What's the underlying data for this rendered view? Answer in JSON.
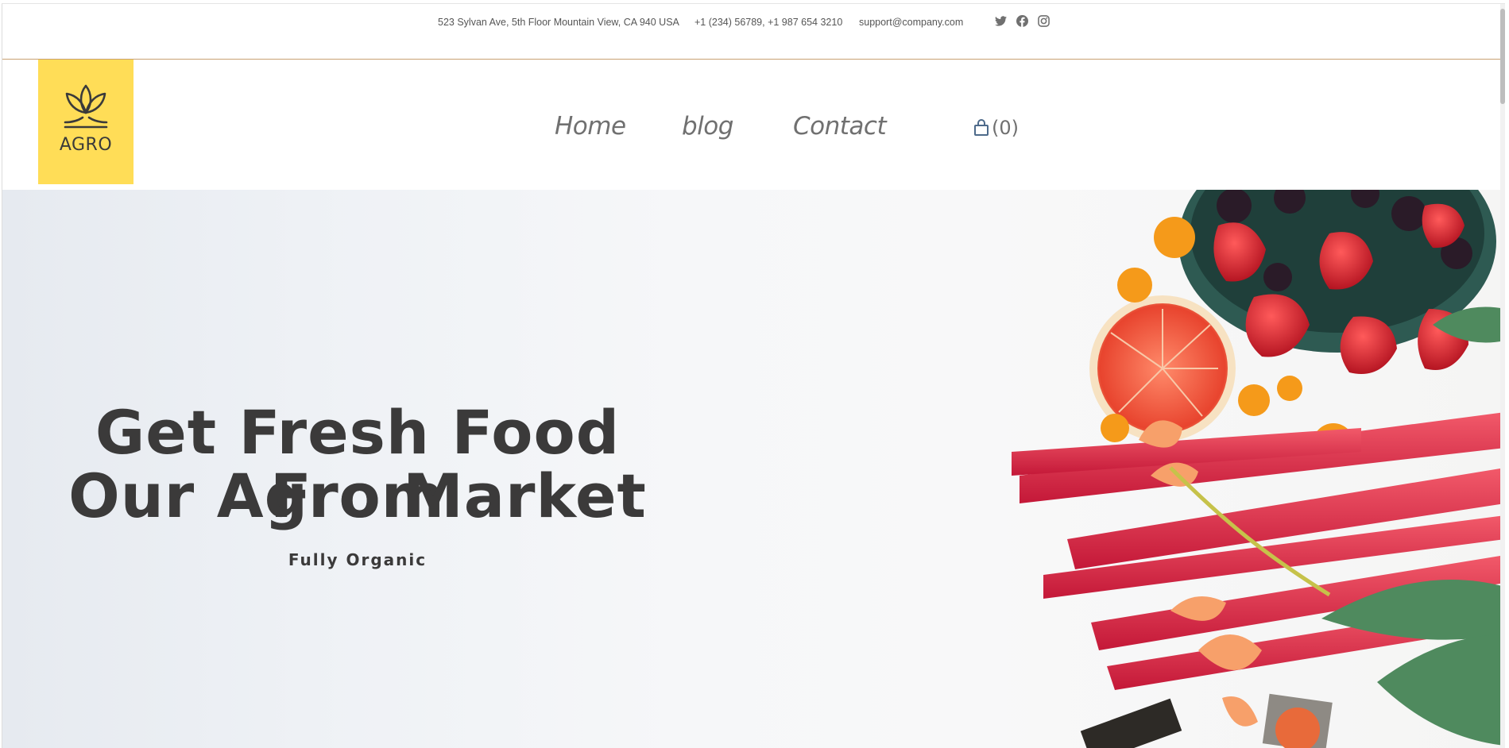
{
  "topbar": {
    "address": "523 Sylvan Ave, 5th Floor Mountain View, CA 940 USA",
    "phones": "+1 (234) 56789, +1 987 654 3210",
    "email": "support@company.com",
    "social_icons": [
      "twitter-icon",
      "facebook-icon",
      "instagram-icon"
    ]
  },
  "logo": {
    "text": "AGRO",
    "background": "#ffdd57"
  },
  "nav": {
    "home": "Home",
    "blog": "blog",
    "contact": "Contact"
  },
  "cart": {
    "count": "(0)",
    "icon": "shopping-bag-icon"
  },
  "hero": {
    "title_line1": "Get Fresh Food From",
    "title_line2": "Our Agro Market",
    "subtitle": "Fully Organic"
  },
  "colors": {
    "accent_line": "#c8a072",
    "text_dark": "#3b3a3a",
    "nav_text": "#707070"
  }
}
